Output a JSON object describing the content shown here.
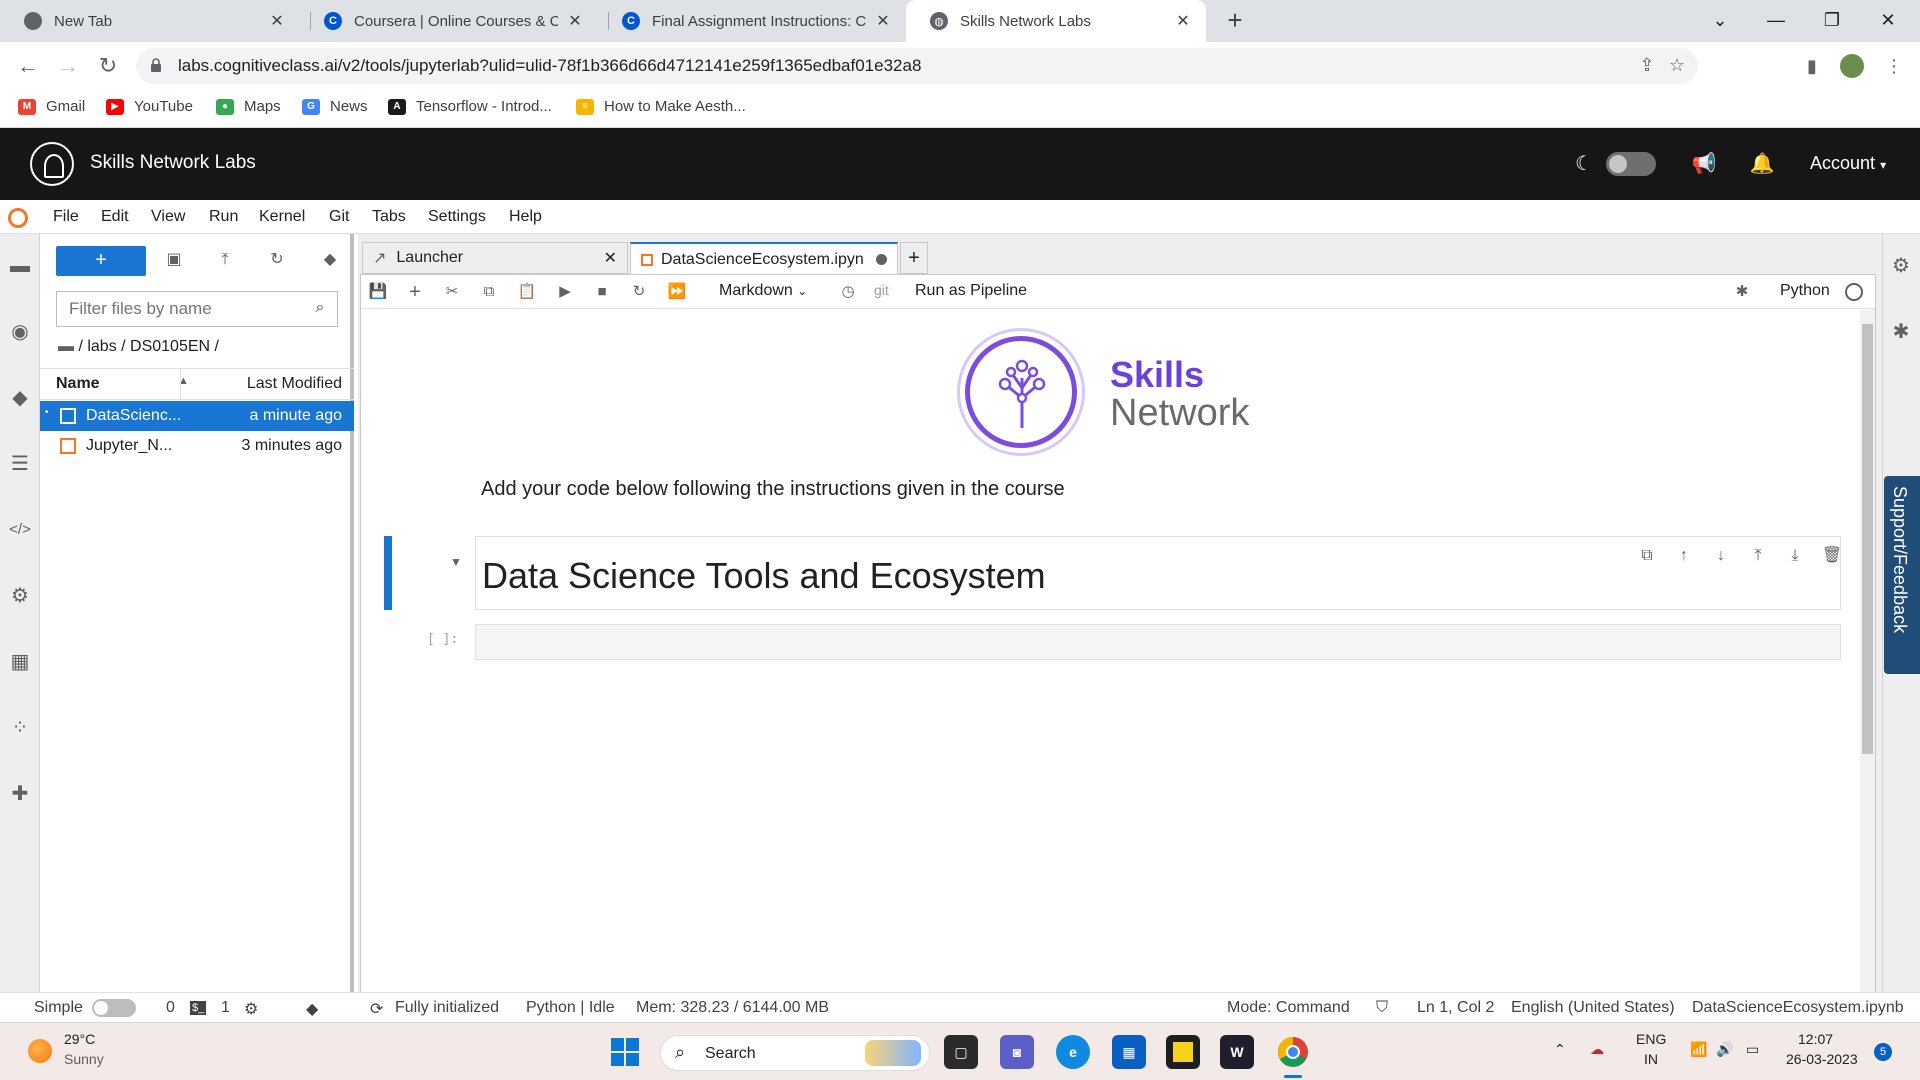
{
  "browser": {
    "tabs": [
      {
        "title": "New Tab",
        "favicon": "chrome-icon",
        "active": false
      },
      {
        "title": "Coursera | Online Courses & Cre",
        "favicon": "coursera-icon",
        "active": false
      },
      {
        "title": "Final Assignment Instructions: Cr",
        "favicon": "coursera-icon",
        "active": false
      },
      {
        "title": "Skills Network Labs",
        "favicon": "globe-icon",
        "active": true
      }
    ],
    "url": "labs.cognitiveclass.ai/v2/tools/jupyterlab?ulid=ulid-78f1b366d66d4712141e259f1365edbaf01e32a8",
    "bookmarks": [
      "Gmail",
      "YouTube",
      "Maps",
      "News",
      "Tensorflow - Introd...",
      "How to Make Aesth..."
    ]
  },
  "sn_header": {
    "title": "Skills Network Labs",
    "account": "Account"
  },
  "menu": [
    "File",
    "Edit",
    "View",
    "Run",
    "Kernel",
    "Git",
    "Tabs",
    "Settings",
    "Help"
  ],
  "file_browser": {
    "new_label": "+",
    "filter_placeholder": "Filter files by name",
    "breadcrumb": "/ labs / DS0105EN /",
    "col_name": "Name",
    "col_modified": "Last Modified",
    "files": [
      {
        "name": "DataScienc...",
        "modified": "a minute ago",
        "selected": true
      },
      {
        "name": "Jupyter_N...",
        "modified": "3 minutes ago",
        "selected": false
      }
    ]
  },
  "doc_tabs": [
    {
      "label": "Launcher",
      "active": false
    },
    {
      "label": "DataScienceEcosystem.ipyn",
      "active": true
    }
  ],
  "notebook_toolbar": {
    "cell_type": "Markdown",
    "git_label": "git",
    "pipeline_label": "Run as Pipeline",
    "kernel_label": "Python"
  },
  "notebook": {
    "brand_line1": "Skills",
    "brand_line2": "Network",
    "instruction": "Add your code below following the instructions given in the course",
    "heading": "Data Science Tools and Ecosystem",
    "prompt": "[ ]:"
  },
  "support_label": "Support/Feedback",
  "status_bar": {
    "simple": "Simple",
    "count0": "0",
    "count1": "1",
    "initialized": "Fully initialized",
    "kernel": "Python | Idle",
    "mem": "Mem: 328.23 / 6144.00 MB",
    "mode": "Mode: Command",
    "position": "Ln 1, Col 2",
    "language": "English (United States)",
    "filename": "DataScienceEcosystem.ipynb"
  },
  "taskbar": {
    "temp": "29°C",
    "weather": "Sunny",
    "search": "Search",
    "lang1": "ENG",
    "lang2": "IN",
    "time": "12:07",
    "date": "26-03-2023",
    "notifications": "5"
  }
}
